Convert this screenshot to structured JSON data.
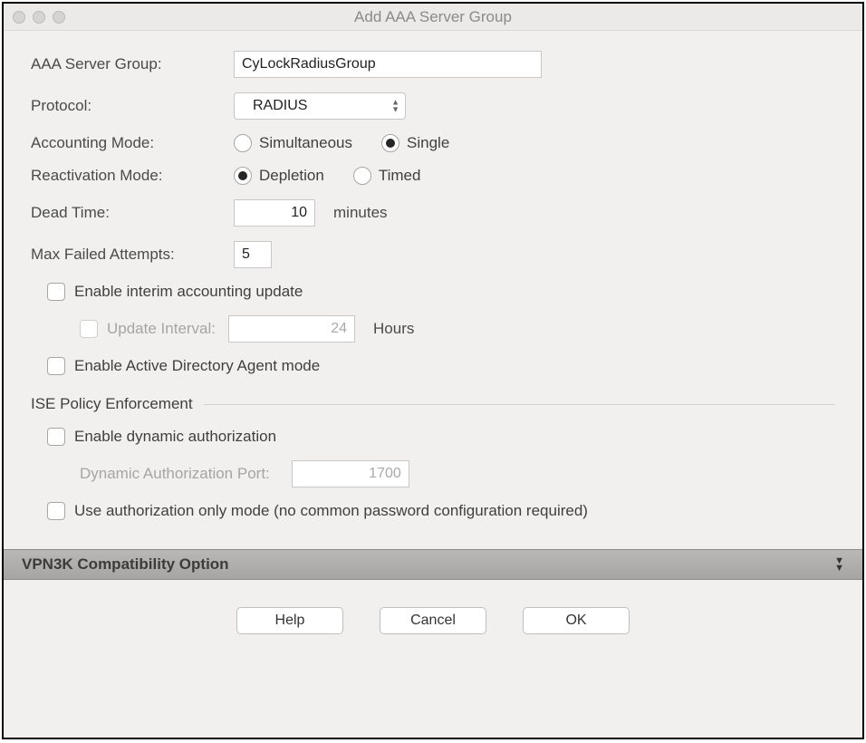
{
  "window": {
    "title": "Add AAA Server Group"
  },
  "fields": {
    "serverGroup": {
      "label": "AAA Server Group:",
      "value": "CyLockRadiusGroup"
    },
    "protocol": {
      "label": "Protocol:",
      "value": "RADIUS"
    },
    "accountingMode": {
      "label": "Accounting Mode:",
      "options": {
        "simultaneous": "Simultaneous",
        "single": "Single"
      },
      "selected": "single"
    },
    "reactivationMode": {
      "label": "Reactivation Mode:",
      "options": {
        "depletion": "Depletion",
        "timed": "Timed"
      },
      "selected": "depletion"
    },
    "deadTime": {
      "label": "Dead Time:",
      "value": "10",
      "unit": "minutes"
    },
    "maxFailed": {
      "label": "Max Failed Attempts:",
      "value": "5"
    },
    "enableInterim": {
      "label": "Enable interim accounting update",
      "checked": false
    },
    "updateInterval": {
      "label": "Update Interval:",
      "value": "24",
      "unit": "Hours"
    },
    "enableADAgent": {
      "label": "Enable Active Directory Agent mode",
      "checked": false
    }
  },
  "ise": {
    "heading": "ISE Policy Enforcement",
    "enableDynamic": {
      "label": "Enable dynamic authorization",
      "checked": false
    },
    "dynPort": {
      "label": "Dynamic Authorization Port:",
      "value": "1700"
    },
    "useAuthOnly": {
      "label": "Use authorization only mode (no common password configuration required)",
      "checked": false
    }
  },
  "expander": {
    "label": "VPN3K Compatibility Option"
  },
  "buttons": {
    "help": "Help",
    "cancel": "Cancel",
    "ok": "OK"
  }
}
